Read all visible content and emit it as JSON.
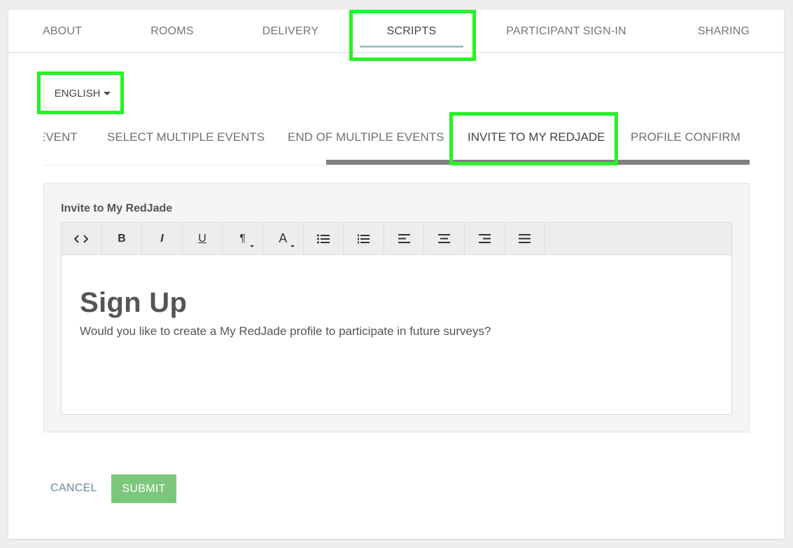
{
  "top_tabs": {
    "about": "ABOUT",
    "rooms": "ROOMS",
    "delivery": "DELIVERY",
    "scripts": "SCRIPTS",
    "participant_sign_in": "PARTICIPANT SIGN-IN",
    "sharing": "SHARING",
    "active": "SCRIPTS"
  },
  "language": {
    "selected": "ENGLISH",
    "icon": "caret-down-icon"
  },
  "script_tabs": {
    "event": "EVENT",
    "select_multiple_events": "SELECT MULTIPLE EVENTS",
    "end_of_multiple_events": "END OF MULTIPLE EVENTS",
    "invite_to_my_redjade": "INVITE TO MY REDJADE",
    "profile_confirm": "PROFILE CONFIRM",
    "active": "INVITE TO MY REDJADE"
  },
  "editor": {
    "label": "Invite to My RedJade",
    "toolbar": {
      "code": "code-view-icon",
      "bold": "B",
      "italic": "I",
      "underline": "U",
      "paragraph": "¶",
      "font_color": "A",
      "unordered_list": "unordered-list-icon",
      "ordered_list": "ordered-list-icon",
      "align_left": "align-left-icon",
      "align_center": "align-center-icon",
      "align_right": "align-right-icon",
      "justify": "justify-icon"
    },
    "content": {
      "heading": "Sign Up",
      "body": "Would you like to create a My RedJade profile to participate in future surveys?"
    }
  },
  "actions": {
    "cancel": "CANCEL",
    "submit": "SUBMIT"
  },
  "colors": {
    "highlight": "#27f227",
    "submit_bg": "#7cc77c",
    "active_tab_underline": "#a5c2c6",
    "scroll_indicator": "#808080",
    "cancel_text": "#6a8a9a"
  }
}
